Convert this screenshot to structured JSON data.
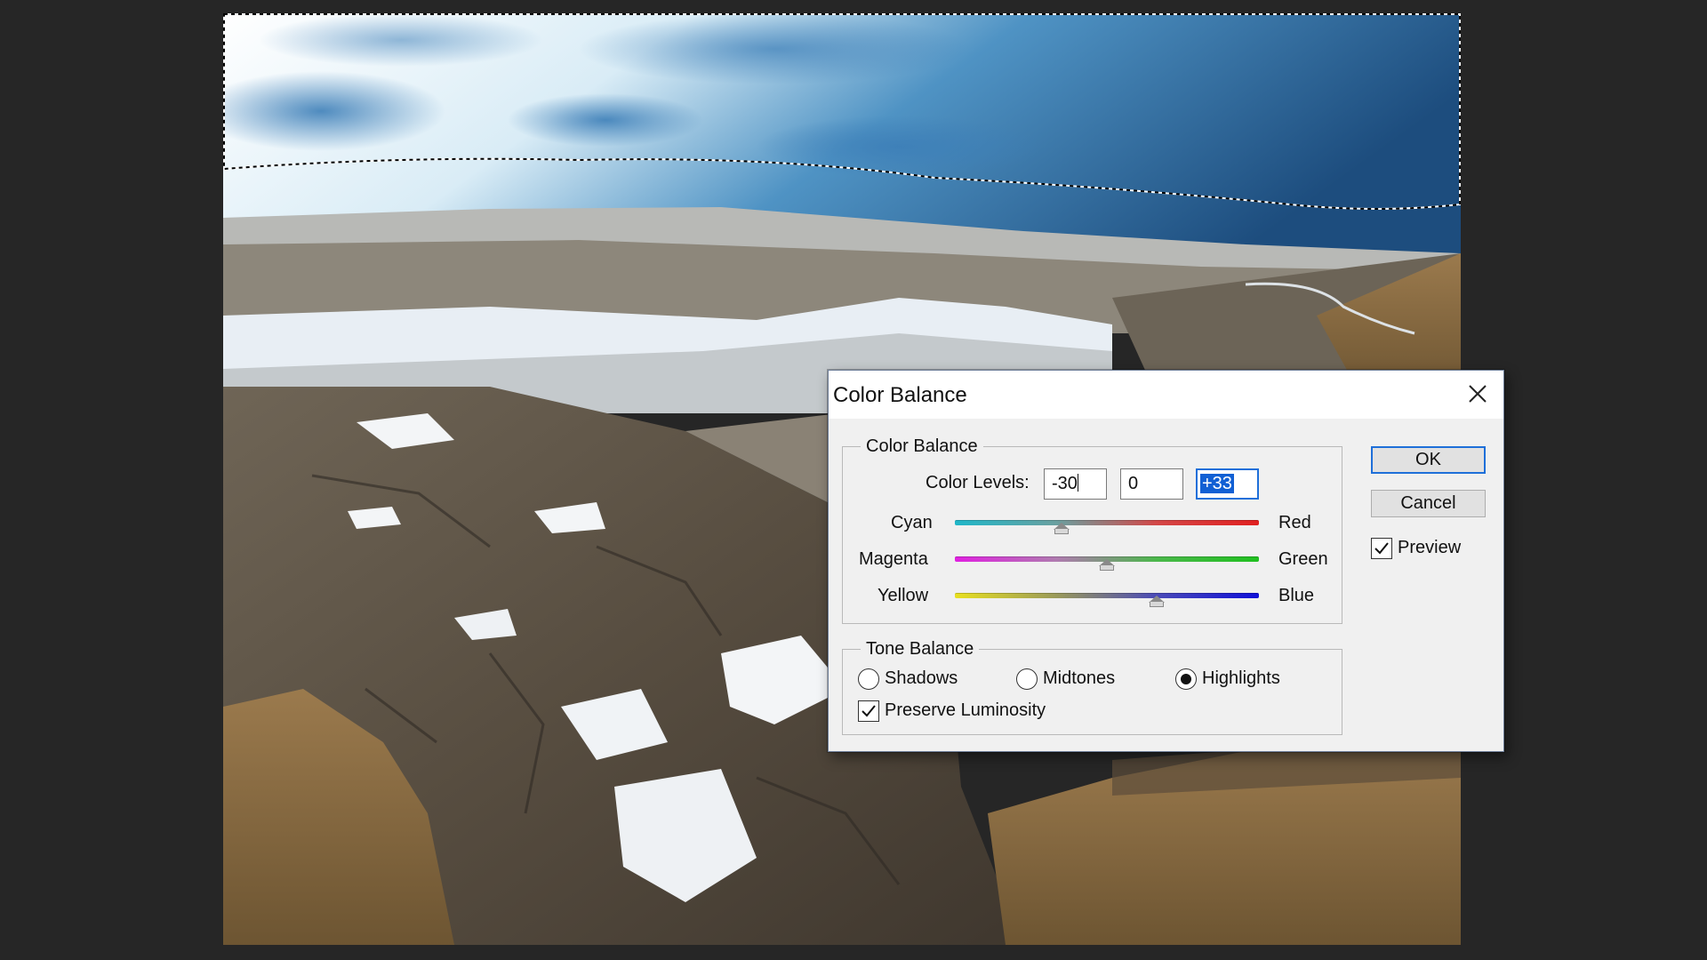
{
  "dialog": {
    "title": "Color Balance",
    "close_icon": "close-icon",
    "color_balance_group": {
      "legend": "Color Balance",
      "color_levels_label": "Color Levels:",
      "levels": [
        "-30",
        "0",
        "+33"
      ],
      "sliders": [
        {
          "left": "Cyan",
          "right": "Red",
          "value": -30
        },
        {
          "left": "Magenta",
          "right": "Green",
          "value": 0
        },
        {
          "left": "Yellow",
          "right": "Blue",
          "value": 33
        }
      ],
      "slider_range": [
        -100,
        100
      ]
    },
    "tone_balance_group": {
      "legend": "Tone Balance",
      "options": [
        "Shadows",
        "Midtones",
        "Highlights"
      ],
      "selected": "Highlights",
      "preserve_luminosity_label": "Preserve Luminosity",
      "preserve_luminosity_checked": true
    },
    "ok_label": "OK",
    "cancel_label": "Cancel",
    "preview_label": "Preview",
    "preview_checked": true
  },
  "colors": {
    "background": "#262626",
    "dialog_bg": "#f0f0f0",
    "focus_accent": "#1e6fd9",
    "selection": "#1160d4"
  }
}
